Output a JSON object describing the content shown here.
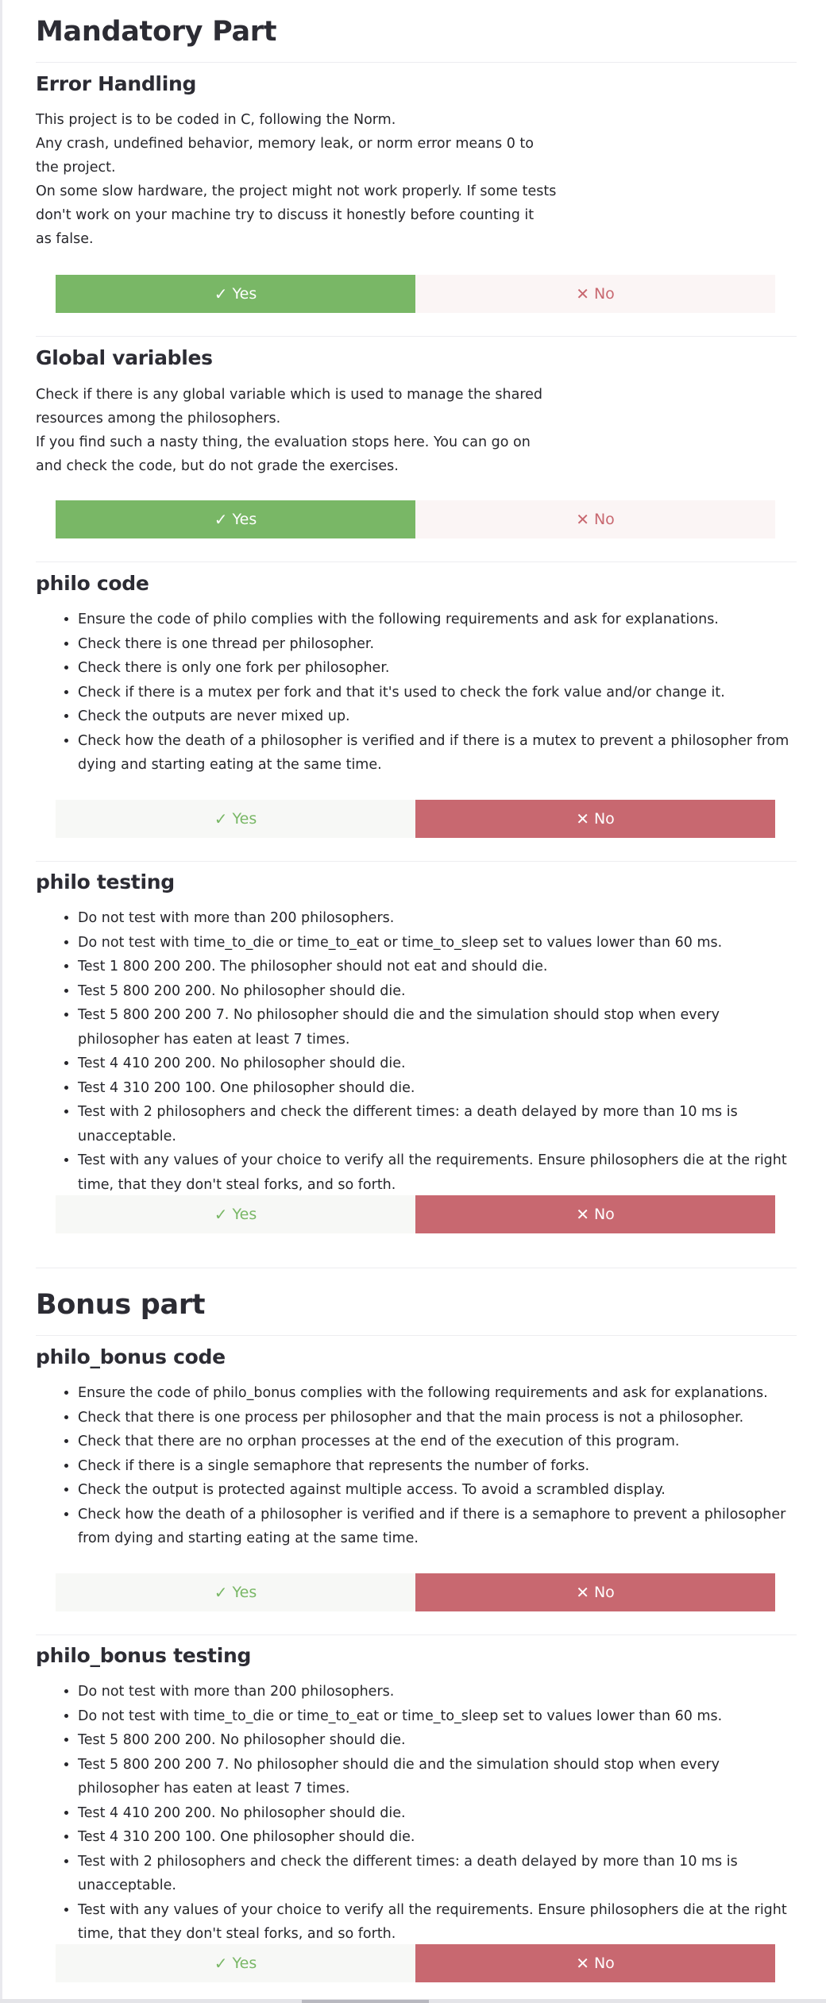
{
  "mandatory": {
    "title": "Mandatory Part",
    "error_handling": {
      "title": "Error Handling",
      "lines": [
        "This project is to be coded in C, following the Norm.",
        "Any crash, undefined behavior, memory leak, or norm error means 0 to",
        "the project.",
        "On some slow hardware, the project might not work properly. If some tests",
        "don't work on your machine try to discuss it honestly before counting it",
        "as false."
      ],
      "yes_label": "Yes",
      "no_label": "No",
      "selected": "yes"
    },
    "global_variables": {
      "title": "Global variables",
      "lines": [
        "Check if there is any global variable which is used to manage the shared",
        "resources among the philosophers.",
        "If you find such a nasty thing, the evaluation stops here. You can go on",
        "and check the code, but do not grade the exercises."
      ],
      "yes_label": "Yes",
      "no_label": "No",
      "selected": "yes"
    },
    "philo_code": {
      "title": "philo code",
      "items": [
        "Ensure the code of philo complies with the following requirements and ask for explanations.",
        "Check there is one thread per philosopher.",
        "Check there is only one fork per philosopher.",
        "Check if there is a mutex per fork and that it's used to check the fork value and/or change it.",
        "Check the outputs are never mixed up.",
        "Check how the death of a philosopher is verified and if there is a mutex to prevent a philosopher from dying and starting eating at the same time."
      ],
      "yes_label": "Yes",
      "no_label": "No",
      "selected": "no"
    },
    "philo_testing": {
      "title": "philo testing",
      "items": [
        "Do not test with more than 200 philosophers.",
        "Do not test with time_to_die or time_to_eat or time_to_sleep set to values lower than 60 ms.",
        "Test 1 800 200 200. The philosopher should not eat and should die.",
        "Test 5 800 200 200. No philosopher should die.",
        "Test 5 800 200 200 7. No philosopher should die and the simulation should stop when every philosopher has eaten at least 7 times.",
        "Test 4 410 200 200. No philosopher should die.",
        "Test 4 310 200 100. One philosopher should die.",
        "Test with 2 philosophers and check the different times: a death delayed by more than 10 ms is unacceptable.",
        "Test with any values of your choice to verify all the requirements. Ensure philosophers die at the right time, that they don't steal forks, and so forth."
      ],
      "yes_label": "Yes",
      "no_label": "No",
      "selected": "no"
    }
  },
  "bonus": {
    "title": "Bonus part",
    "philo_bonus_code": {
      "title": "philo_bonus code",
      "items": [
        "Ensure the code of philo_bonus complies with the following requirements and ask for explanations.",
        "Check that there is one process per philosopher and that the main process is not a philosopher.",
        "Check that there are no orphan processes at the end of the execution of this program.",
        "Check if there is a single semaphore that represents the number of forks.",
        "Check the output is protected against multiple access. To avoid a scrambled display.",
        "Check how the death of a philosopher is verified and if there is a semaphore to prevent a philosopher from dying and starting eating at the same time."
      ],
      "yes_label": "Yes",
      "no_label": "No",
      "selected": "no"
    },
    "philo_bonus_testing": {
      "title": "philo_bonus testing",
      "items": [
        "Do not test with more than 200 philosophers.",
        "Do not test with time_to_die or time_to_eat or time_to_sleep set to values lower than 60 ms.",
        "Test 5 800 200 200. No philosopher should die.",
        "Test 5 800 200 200 7. No philosopher should die and the simulation should stop when every philosopher has eaten at least 7 times.",
        "Test 4 410 200 200. No philosopher should die.",
        "Test 4 310 200 100. One philosopher should die.",
        "Test with 2 philosophers and check the different times: a death delayed by more than 10 ms is unacceptable.",
        "Test with any values of your choice to verify all the requirements. Ensure philosophers die at the right time, that they don't steal forks, and so forth."
      ],
      "yes_label": "Yes",
      "no_label": "No",
      "selected": "no"
    }
  },
  "icons": {
    "yes": "check-icon",
    "no": "cross-icon"
  },
  "colors": {
    "yes": "#79b766",
    "no": "#c86870",
    "text": "#2c2c34"
  }
}
